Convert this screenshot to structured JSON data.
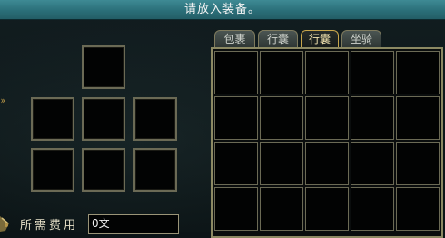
{
  "header": {
    "prompt": "请放入装备。"
  },
  "tabs": [
    {
      "label": "包裹",
      "active": false
    },
    {
      "label": "行囊",
      "active": false
    },
    {
      "label": "行囊",
      "active": true
    },
    {
      "label": "坐骑",
      "active": false
    }
  ],
  "fee": {
    "label": "所需费用",
    "value": "0文"
  },
  "colors": {
    "accent": "#c8a64b",
    "header_bar": "#2f7580",
    "slot_border": "#6b6a55"
  }
}
